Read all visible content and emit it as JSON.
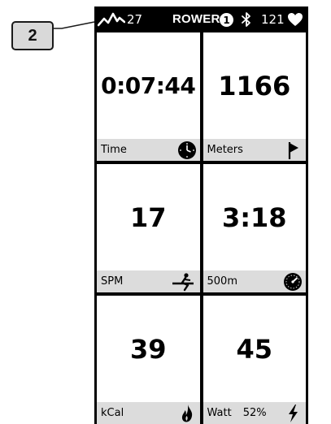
{
  "callout": {
    "number": "2"
  },
  "status_bar": {
    "graph_icon": "activity-graph-icon",
    "graph_value": "27",
    "mode": "ROWER",
    "badge": "1",
    "bluetooth_icon": "bluetooth-icon",
    "heart_rate": "121",
    "heart_icon": "heart-icon"
  },
  "tiles": [
    {
      "value": "0:07:44",
      "label": "Time",
      "icon": "clock-icon"
    },
    {
      "value": "1166",
      "label": "Meters",
      "icon": "flag-icon"
    },
    {
      "value": "17",
      "label": "SPM",
      "icon": "rower-icon"
    },
    {
      "value": "3:18",
      "label": "500m",
      "icon": "speedometer-icon"
    },
    {
      "value": "39",
      "label": "kCal",
      "icon": "flame-icon"
    },
    {
      "value": "45",
      "label": "Watt",
      "extra": "52%",
      "icon": "lightning-icon"
    }
  ]
}
